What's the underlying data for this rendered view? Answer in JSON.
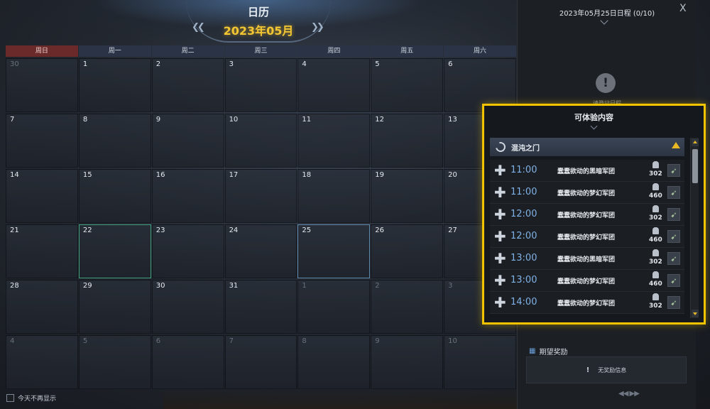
{
  "header": {
    "title": "日历",
    "month": "2023年05月",
    "prev_icon": "double-chevron-left-icon",
    "next_icon": "double-chevron-right-icon"
  },
  "weekdays": [
    "周日",
    "周一",
    "周二",
    "周三",
    "周四",
    "周五",
    "周六"
  ],
  "days": [
    {
      "n": "30",
      "other": true
    },
    {
      "n": "1"
    },
    {
      "n": "2"
    },
    {
      "n": "3"
    },
    {
      "n": "4"
    },
    {
      "n": "5"
    },
    {
      "n": "6"
    },
    {
      "n": "7"
    },
    {
      "n": "8"
    },
    {
      "n": "9"
    },
    {
      "n": "10"
    },
    {
      "n": "11"
    },
    {
      "n": "12"
    },
    {
      "n": "13"
    },
    {
      "n": "14"
    },
    {
      "n": "15"
    },
    {
      "n": "16"
    },
    {
      "n": "17"
    },
    {
      "n": "18"
    },
    {
      "n": "19"
    },
    {
      "n": "20"
    },
    {
      "n": "21"
    },
    {
      "n": "22",
      "mark": "green"
    },
    {
      "n": "23"
    },
    {
      "n": "24"
    },
    {
      "n": "25",
      "mark": "blue"
    },
    {
      "n": "26"
    },
    {
      "n": "27"
    },
    {
      "n": "28"
    },
    {
      "n": "29"
    },
    {
      "n": "30"
    },
    {
      "n": "31"
    },
    {
      "n": "1",
      "other": true
    },
    {
      "n": "2",
      "other": true
    },
    {
      "n": "3",
      "other": true
    },
    {
      "n": "4",
      "other": true
    },
    {
      "n": "5",
      "other": true
    },
    {
      "n": "6",
      "other": true
    },
    {
      "n": "7",
      "other": true
    },
    {
      "n": "8",
      "other": true
    },
    {
      "n": "9",
      "other": true
    },
    {
      "n": "10",
      "other": true
    }
  ],
  "footer": {
    "dont_show_label": "今天不再显示"
  },
  "side_panel": {
    "title": "2023年05月25日日程 (0/10)",
    "close_label": "X",
    "empty_text": "请登记日程",
    "reward_title": "期望奖励",
    "reward_empty": "无奖励信息",
    "reward_warn": "!",
    "page_arrows": "◀◀ ▶▶"
  },
  "popup": {
    "title": "可体验内容",
    "group_label": "混沌之门",
    "rows": [
      {
        "time": "11:00",
        "name": "蠢蠢欲动的黑暗军团",
        "level": "302"
      },
      {
        "time": "11:00",
        "name": "蠢蠢欲动的梦幻军团",
        "level": "460"
      },
      {
        "time": "12:00",
        "name": "蠢蠢欲动的梦幻军团",
        "level": "302"
      },
      {
        "time": "12:00",
        "name": "蠢蠢欲动的梦幻军团",
        "level": "460"
      },
      {
        "time": "13:00",
        "name": "蠢蠢欲动的黑暗军团",
        "level": "302"
      },
      {
        "time": "13:00",
        "name": "蠢蠢欲动的梦幻军团",
        "level": "460"
      },
      {
        "time": "14:00",
        "name": "蠢蠢欲动的梦幻军团",
        "level": "302"
      }
    ]
  },
  "colors": {
    "accent_gold": "#f2c400",
    "month_yellow": "#f3c634",
    "time_blue": "#7fb2e6",
    "sunday_red": "#6b2a2a"
  }
}
